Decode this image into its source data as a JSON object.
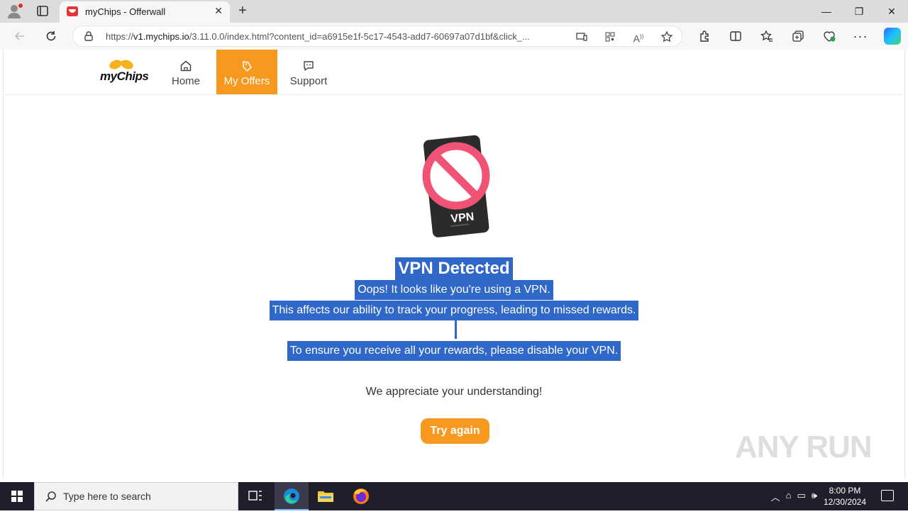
{
  "browser": {
    "tab_title": "myChips - Offerwall",
    "tab_close": "✕",
    "new_tab": "+",
    "url_prefix": "https://",
    "url_host": "v1.mychips.io",
    "url_rest": "/3.11.0.0/index.html?content_id=a6915e1f-5c17-4543-add7-60697a07d1bf&click_...",
    "window_controls": [
      "—",
      "❐",
      "✕"
    ]
  },
  "site": {
    "logo_text": "myChips",
    "nav": {
      "home": "Home",
      "offers": "My Offers",
      "support": "Support"
    },
    "accent_color": "#f7991e"
  },
  "message": {
    "vpn_badge": "VPN",
    "title": "VPN Detected",
    "line1": "Oops! It looks like you're using a VPN.",
    "line2": "This affects our ability to track your progress, leading to missed rewards.",
    "line3": "To ensure you receive all your rewards, please disable your VPN.",
    "line4": "We appreciate your understanding!",
    "button": "Try again"
  },
  "watermark": "ANY RUN",
  "taskbar": {
    "search_placeholder": "Type here to search",
    "time": "8:00 PM",
    "date": "12/30/2024"
  }
}
